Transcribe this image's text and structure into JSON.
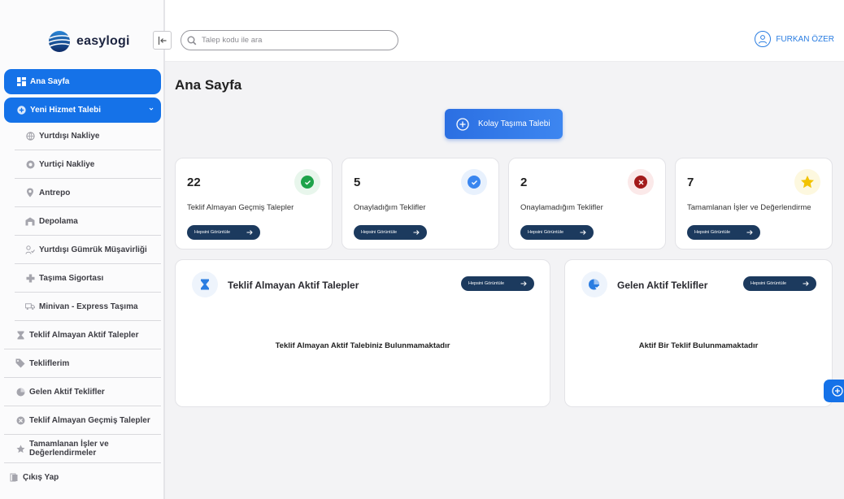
{
  "brand": {
    "name": "easylogi"
  },
  "search": {
    "placeholder": "Talep kodu ile ara"
  },
  "user": {
    "name": "FURKAN ÖZER"
  },
  "sidebar": {
    "home": "Ana Sayfa",
    "new_request": "Yeni Hizmet Talebi",
    "sub_items": [
      "Yurtdışı Nakliye",
      "Yurtiçi Nakliye",
      "Antrepo",
      "Depolama",
      "Yurtdışı Gümrük Müşavirliği",
      "Taşıma Sigortası",
      "Minivan - Express Taşıma"
    ],
    "items": [
      "Teklif Almayan Aktif Talepler",
      "Tekliflerim",
      "Gelen Aktif Teklifler",
      "Teklif Almayan Geçmiş Talepler",
      "Tamamlanan İşler ve Değerlendirmeler"
    ],
    "logout": "Çıkış Yap"
  },
  "main": {
    "title": "Ana Sayfa",
    "primary_button": "Kolay Taşıma Talebi",
    "view_all": "Hepsini Görüntüle",
    "stats": [
      {
        "value": "22",
        "label": "Teklif Almayan Geçmiş Talepler",
        "icon": "check-icon",
        "color": "#1ea34a"
      },
      {
        "value": "5",
        "label": "Onayladığım Teklifler",
        "icon": "check-icon",
        "color": "#3a86ef"
      },
      {
        "value": "2",
        "label": "Onaylamadığım Teklifler",
        "icon": "close-icon",
        "color": "#a31b1b"
      },
      {
        "value": "7",
        "label": "Tamamlanan İşler ve Değerlendirme",
        "icon": "star-icon",
        "color": "#f2c200"
      }
    ],
    "panels": [
      {
        "title": "Teklif Almayan Aktif Talepler",
        "empty": "Teklif Almayan Aktif Talebiniz Bulunmamaktadır"
      },
      {
        "title": "Gelen Aktif Teklifler",
        "empty": "Aktif Bir Teklif Bulunmamaktadır"
      }
    ]
  },
  "colors": {
    "accent": "#1572e8",
    "pill": "#1c3a5e"
  }
}
